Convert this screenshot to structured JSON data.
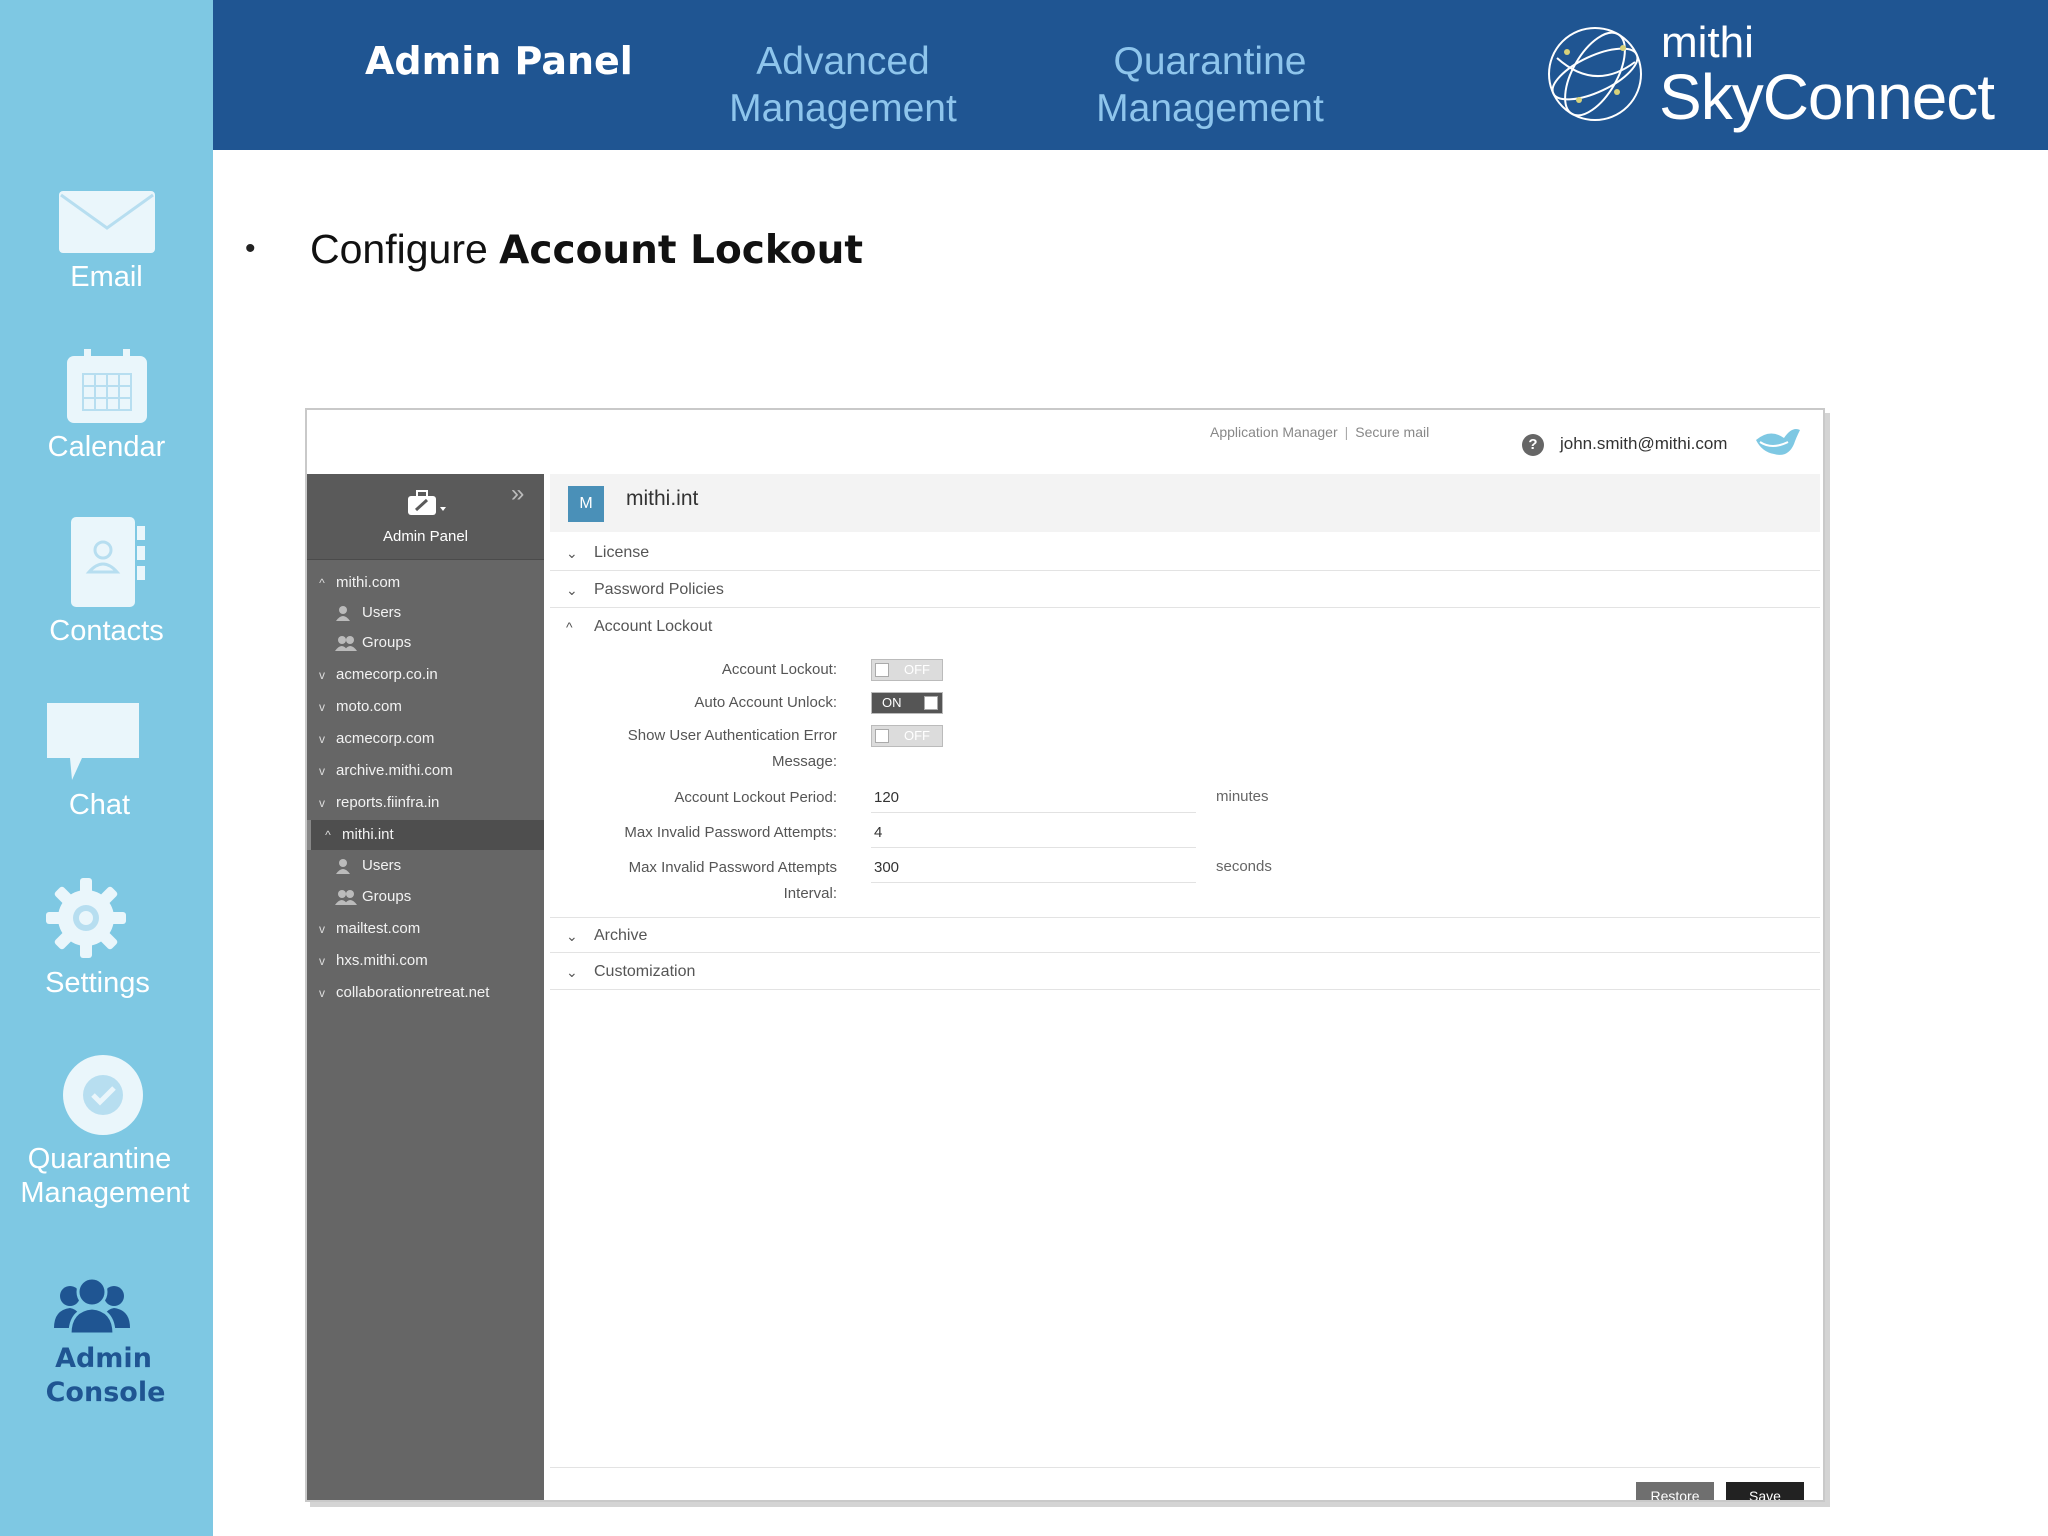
{
  "sidebar": {
    "items": [
      {
        "label": "Email",
        "icon": "email-icon"
      },
      {
        "label": "Calendar",
        "icon": "calendar-icon"
      },
      {
        "label": "Contacts",
        "icon": "contacts-icon"
      },
      {
        "label": "Chat",
        "icon": "chat-icon"
      },
      {
        "label": "Settings",
        "icon": "settings-icon"
      },
      {
        "label_line1": "Quarantine",
        "label_line2": "Management",
        "icon": "check-circle-icon"
      },
      {
        "label_line1": "Admin",
        "label_line2": "Console",
        "icon": "users-icon"
      }
    ]
  },
  "header": {
    "tabs": [
      {
        "label": "Admin Panel",
        "active": true
      },
      {
        "line1": "Advanced",
        "line2": "Management"
      },
      {
        "line1": "Quarantine",
        "line2": "Management"
      }
    ],
    "brand_small": "mithi",
    "brand_large": "SkyConnect"
  },
  "slide": {
    "bullet": "•",
    "heading_prefix": "Configure ",
    "heading_bold": "Account Lockout"
  },
  "app": {
    "top_links": [
      "Application Manager",
      "|",
      "Secure mail"
    ],
    "user_email": "john.smith@mithi.com",
    "nav": {
      "title": "Admin Panel",
      "rows": [
        {
          "label": "mithi.com",
          "caret": "^",
          "level": 0
        },
        {
          "label": "Users",
          "level": 1,
          "icon": "user-icon"
        },
        {
          "label": "Groups",
          "level": 1,
          "icon": "group-icon"
        },
        {
          "label": "acmecorp.co.in",
          "caret": "v",
          "level": 0
        },
        {
          "label": "moto.com",
          "caret": "v",
          "level": 0
        },
        {
          "label": "acmecorp.com",
          "caret": "v",
          "level": 0
        },
        {
          "label": "archive.mithi.com",
          "caret": "v",
          "level": 0
        },
        {
          "label": "reports.fiinfra.in",
          "caret": "v",
          "level": 0
        },
        {
          "label": "mithi.int",
          "caret": "^",
          "level": 0,
          "selected": true
        },
        {
          "label": "Users",
          "level": 1,
          "icon": "user-icon"
        },
        {
          "label": "Groups",
          "level": 1,
          "icon": "group-icon"
        },
        {
          "label": "mailtest.com",
          "caret": "v",
          "level": 0
        },
        {
          "label": "hxs.mithi.com",
          "caret": "v",
          "level": 0
        },
        {
          "label": "collaborationretreat.net",
          "caret": "v",
          "level": 0
        }
      ]
    },
    "domain": {
      "badge": "M",
      "name": "mithi.int"
    },
    "sections": {
      "license": "License",
      "password_policies": "Password Policies",
      "account_lockout": "Account Lockout",
      "archive": "Archive",
      "customization": "Customization"
    },
    "lockout_form": {
      "account_lockout_label": "Account Lockout:",
      "account_lockout_value": "OFF",
      "auto_unlock_label": "Auto Account Unlock:",
      "auto_unlock_value": "ON",
      "show_error_label_1": "Show User Authentication Error",
      "show_error_label_2": "Message:",
      "show_error_value": "OFF",
      "period_label": "Account Lockout Period:",
      "period_value": "120",
      "period_unit": "minutes",
      "max_attempts_label": "Max Invalid Password Attempts:",
      "max_attempts_value": "4",
      "interval_label_1": "Max Invalid Password Attempts",
      "interval_label_2": "Interval:",
      "interval_value": "300",
      "interval_unit": "seconds"
    },
    "buttons": {
      "restore": "Restore",
      "save": "Save"
    }
  },
  "colors": {
    "sidebar_bg": "#7ec8e3",
    "header_bg": "#1f5592",
    "header_inactive_text": "#8ec5ec",
    "admin_console_text": "#1f5592",
    "nav_bg": "#666666"
  }
}
